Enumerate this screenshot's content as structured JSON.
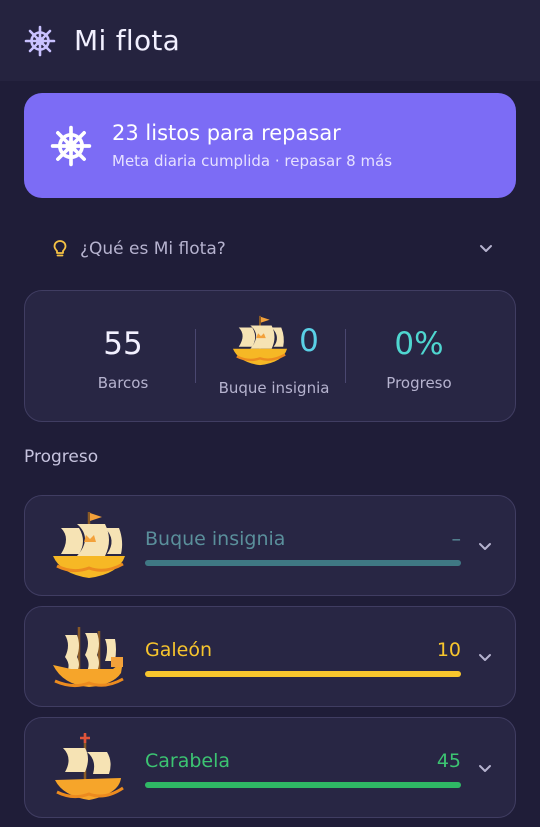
{
  "app": {
    "title": "Mi flota",
    "icon": "ships-wheel-icon"
  },
  "banner": {
    "title": "23 listos para repasar",
    "subtitle": "Meta diaria cumplida · repasar 8 más",
    "icon": "ships-wheel-icon",
    "color": "#7c6cf5"
  },
  "faq": {
    "label": "¿Qué es Mi flota?",
    "icon": "lightbulb-icon"
  },
  "stats": {
    "ships": {
      "value": "55",
      "label": "Barcos"
    },
    "flagship": {
      "value": "0",
      "label": "Buque insignia",
      "icon": "flagship-icon"
    },
    "progress": {
      "value": "0%",
      "label": "Progreso"
    }
  },
  "section_title": "Progreso",
  "tiers": [
    {
      "name": "Buque insignia",
      "count": "–",
      "fill": 1.0,
      "color": "#3f7884",
      "text_color": "#5a8f9b",
      "icon": "flagship-icon"
    },
    {
      "name": "Galeón",
      "count": "10",
      "fill": 1.0,
      "color": "#f7c52d",
      "text_color": "#f7c52d",
      "icon": "galleon-icon"
    },
    {
      "name": "Carabela",
      "count": "45",
      "fill": 1.0,
      "color": "#2fb865",
      "text_color": "#3cc472",
      "icon": "caravel-icon"
    }
  ]
}
